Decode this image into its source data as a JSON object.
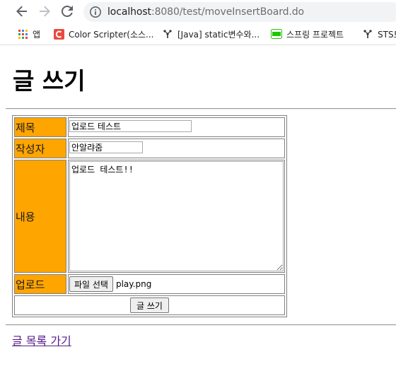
{
  "browser": {
    "url_host": "localhost",
    "url_rest": ":8080/test/moveInsertBoard.do",
    "bookmarks": [
      {
        "label": "앱",
        "icon": "apps-grid-icon"
      },
      {
        "label": "Color Scripter(소스...",
        "icon": "color-scripter-icon"
      },
      {
        "label": "[Java] static변수와...",
        "icon": "tree-icon"
      },
      {
        "label": "스프링 프로젝트",
        "icon": "blog-icon"
      },
      {
        "label": "STS트",
        "icon": "tree-icon"
      }
    ]
  },
  "colors": {
    "label_cell": "#ffa500",
    "visited_link": "#551a8b",
    "color_scripter": "#e94a3f",
    "blog_green": "#1ec800"
  },
  "page": {
    "title": "글 쓰기",
    "form": {
      "title_label": "제목",
      "title_value": "업로드 테스트",
      "writer_label": "작성자",
      "writer_value": "안알랴줌",
      "content_label": "내용",
      "content_value": "업로드 테스트!!",
      "upload_label": "업로드",
      "file_button_label": "파일 선택",
      "file_name": "play.png",
      "submit_label": "글 쓰기"
    },
    "list_link": "글 목록 가기"
  }
}
